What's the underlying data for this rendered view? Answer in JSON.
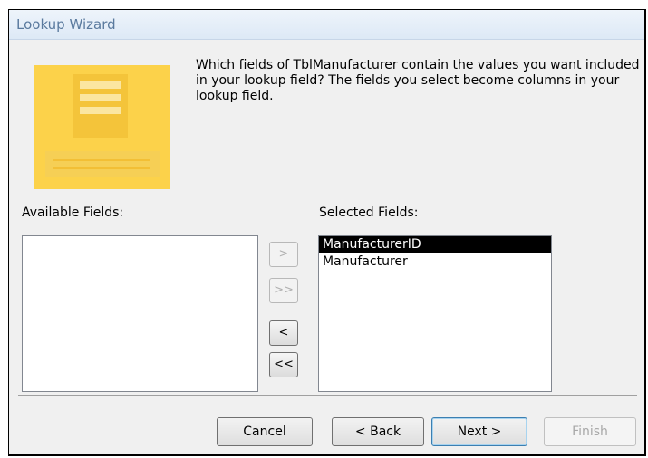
{
  "window": {
    "title": "Lookup Wizard"
  },
  "instructions": "Which fields of TblManufacturer contain the values you want included in your lookup field? The fields you select become columns in your lookup field.",
  "available_fields": {
    "label": "Available Fields:",
    "items": []
  },
  "selected_fields": {
    "label": "Selected Fields:",
    "items": [
      "ManufacturerID",
      "Manufacturer"
    ],
    "selected_index": 0
  },
  "move_buttons": {
    "add_one": ">",
    "add_all": ">>",
    "remove_one": "<",
    "remove_all": "<<"
  },
  "footer": {
    "cancel": "Cancel",
    "back": "< Back",
    "next": "Next >",
    "finish": "Finish"
  }
}
